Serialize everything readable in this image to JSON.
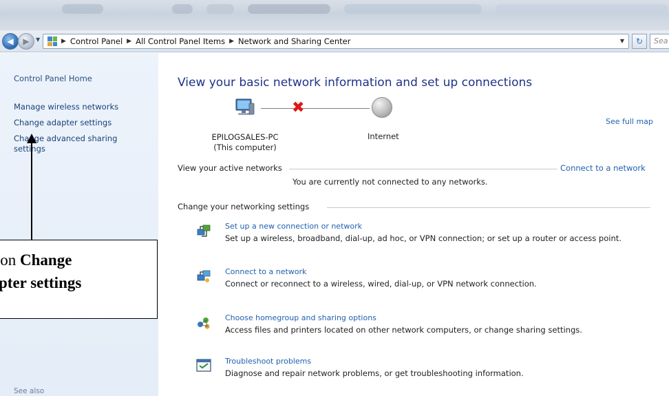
{
  "window": {
    "search_placeholder": "Sea"
  },
  "address_bar": {
    "crumbs": [
      "Control Panel",
      "All Control Panel Items",
      "Network and Sharing Center"
    ]
  },
  "left_pane": {
    "control_panel_home": "Control Panel Home",
    "manage_wireless": "Manage wireless networks",
    "change_adapter": "Change adapter settings",
    "change_advanced": "Change advanced sharing settings",
    "see_also": "See also"
  },
  "main": {
    "title": "View your basic network information and set up connections",
    "see_full_map": "See full map",
    "computer_name": "EPILOGSALES-PC",
    "computer_sub": "(This computer)",
    "internet_label": "Internet",
    "active_networks_label": "View your active networks",
    "connect_to_network_link": "Connect to a network",
    "not_connected_text": "You are currently not connected to any networks.",
    "networking_settings_label": "Change your networking settings",
    "tasks": [
      {
        "icon": "new-connection-icon",
        "link": "Set up a new connection or network",
        "desc": "Set up a wireless, broadband, dial-up, ad hoc, or VPN connection; or set up a router or access point."
      },
      {
        "icon": "connect-network-icon",
        "link": "Connect to a network",
        "desc": "Connect or reconnect to a wireless, wired, dial-up, or VPN network connection."
      },
      {
        "icon": "homegroup-icon",
        "link": "Choose homegroup and sharing options",
        "desc": "Access files and printers located on other network computers, or change sharing settings."
      },
      {
        "icon": "troubleshoot-icon",
        "link": "Troubleshoot problems",
        "desc": "Diagnose and repair network problems, or get troubleshooting information."
      }
    ]
  },
  "callout": {
    "line1_prefix": "k on ",
    "line1_bold": "Change",
    "line2": "pter settings"
  },
  "colors": {
    "link": "#1f5fb0",
    "title": "#1e3287",
    "error_x": "#e01616"
  }
}
